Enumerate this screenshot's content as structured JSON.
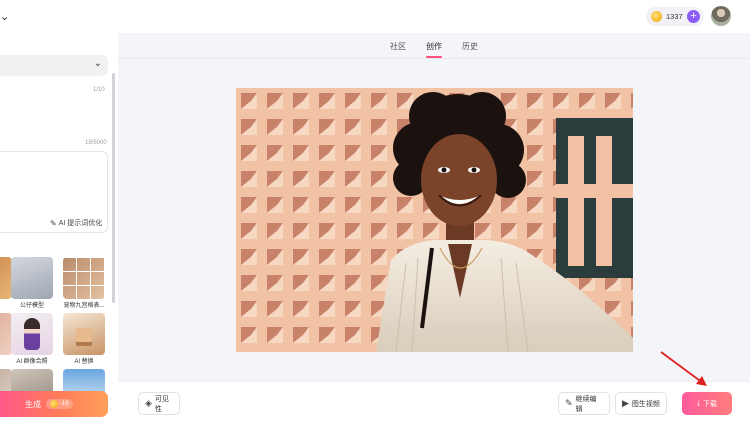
{
  "header": {
    "credits": "1337",
    "plus": "+",
    "top_left_caret": "⌄"
  },
  "left_panel": {
    "model_select_chevron": "⌄",
    "title_counter": "1/10",
    "prompt_counter": "18/5000",
    "ai_optimize_label": "AI 提示词优化",
    "templates": [
      {
        "label": "公仔模型"
      },
      {
        "label": "宠物九宫格表..."
      },
      {
        "label": "AI 群像合照"
      },
      {
        "label": "AI 替换"
      }
    ],
    "generate": {
      "label": "生成",
      "cost": "-16"
    }
  },
  "main": {
    "tabs": [
      {
        "label": "社区"
      },
      {
        "label": "创作"
      },
      {
        "label": "历史"
      }
    ],
    "active_tab": "创作"
  },
  "toolbar": {
    "visibility_label": "可见性",
    "continue_edit_label": "继续编辑",
    "image_to_video_label": "图生视频",
    "download_label": "下载"
  },
  "colors": {
    "accent_pink": "#ff4f7a",
    "annotation_red": "#e02020",
    "credit_plus": "#8b5cf6"
  },
  "icons": {
    "coin": "coin-icon",
    "visibility": "visibility-icon",
    "continue_edit": "pencil-icon",
    "image_to_video": "play-icon",
    "download": "download-icon",
    "ai_optimize": "wand-icon"
  }
}
